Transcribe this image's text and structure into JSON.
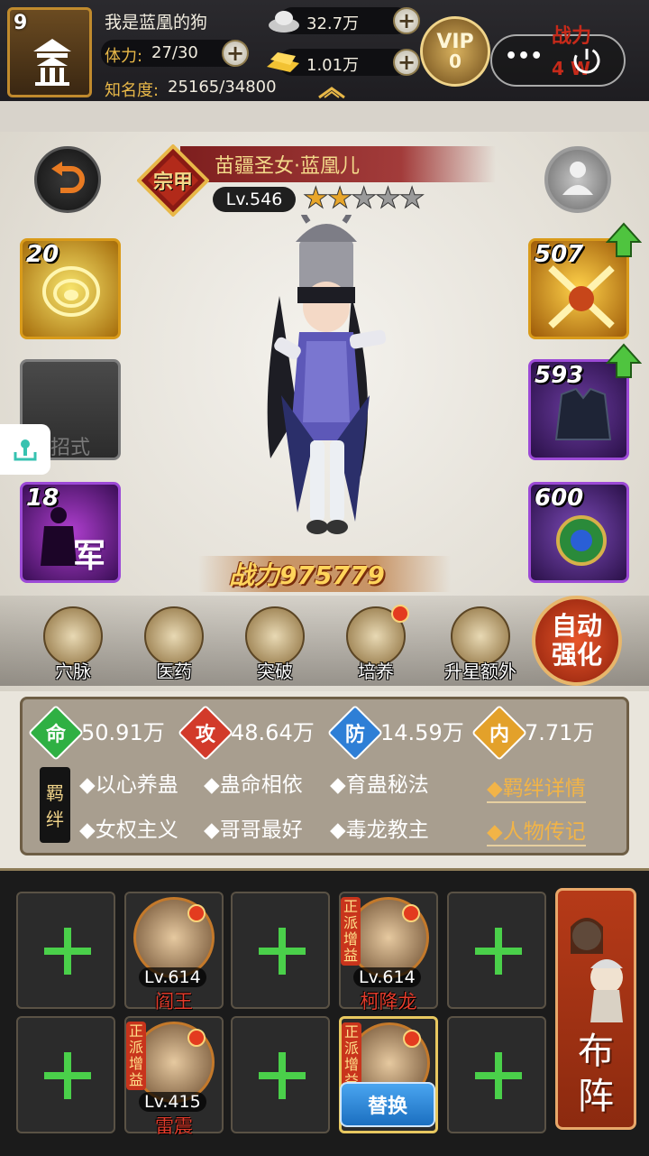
{
  "player": {
    "level": "9",
    "name": "我是蓝凰的狗",
    "stamina_label": "体力:",
    "stamina_value": "27/30",
    "fame_label": "知名度:",
    "fame_value": "25165/34800"
  },
  "currency": {
    "silver": "32.7万",
    "gold": "1.01万"
  },
  "vip": {
    "label": "VIP",
    "level": "0"
  },
  "top_right": {
    "menu_glyph": "•••",
    "power_label": "战力",
    "power_partial": "4 W"
  },
  "hero": {
    "name": "苗疆圣女·蓝凰儿",
    "rarity_tag": "宗甲",
    "level": "Lv.546",
    "stars_filled": 2,
    "stars_total": 5,
    "power_label": "战力",
    "power_value": "975779"
  },
  "skills": [
    {
      "num": "20",
      "color": "gold"
    },
    {
      "num": "",
      "label": "招式",
      "color": "gray"
    },
    {
      "num": "18",
      "label": "军",
      "color": "purple"
    }
  ],
  "equipment": [
    {
      "num": "507",
      "color": "gold"
    },
    {
      "num": "593",
      "color": "purple"
    },
    {
      "num": "600",
      "color": "purple"
    }
  ],
  "actions": [
    {
      "label": "穴脉",
      "icon": "meridian-icon",
      "dot": false
    },
    {
      "label": "医药",
      "icon": "mushroom-icon",
      "dot": false
    },
    {
      "label": "突破",
      "icon": "breakthrough-icon",
      "dot": false
    },
    {
      "label": "培养",
      "icon": "scroll-icon",
      "dot": true
    },
    {
      "label": "升星额外",
      "icon": "gift-icon",
      "dot": false
    }
  ],
  "auto_enhance": {
    "line1": "自动",
    "line2": "强化"
  },
  "stats": [
    {
      "key": "命",
      "value": "50.91万",
      "color": "#2fb043"
    },
    {
      "key": "攻",
      "value": "48.64万",
      "color": "#d23a2a"
    },
    {
      "key": "防",
      "value": "14.59万",
      "color": "#2e7fd6"
    },
    {
      "key": "内",
      "value": "7.71万",
      "color": "#e3a12a"
    }
  ],
  "fetter": {
    "tag_top": "羁",
    "tag_bottom": "绊",
    "items": [
      "以心养蛊",
      "蛊命相依",
      "育蛊秘法",
      "女权主义",
      "哥哥最好",
      "毒龙教主"
    ],
    "link_details": "◆羁绊详情",
    "link_bio": "◆人物传记"
  },
  "formation": {
    "heroes": [
      {
        "level": "Lv.614",
        "name": "阎王"
      },
      {
        "level": "Lv.614",
        "name": "柯降龙",
        "badge": "正派增益"
      },
      {
        "level": "Lv.415",
        "name": "雷震",
        "badge": "正派增益"
      },
      {
        "badge": "正派增益"
      }
    ],
    "swap_label": "替换",
    "buzhen_label": "布阵"
  },
  "colors": {
    "accent_gold": "#e8b848",
    "bg_dark": "#1b1b1b",
    "bg_light": "#e9e5dc"
  }
}
